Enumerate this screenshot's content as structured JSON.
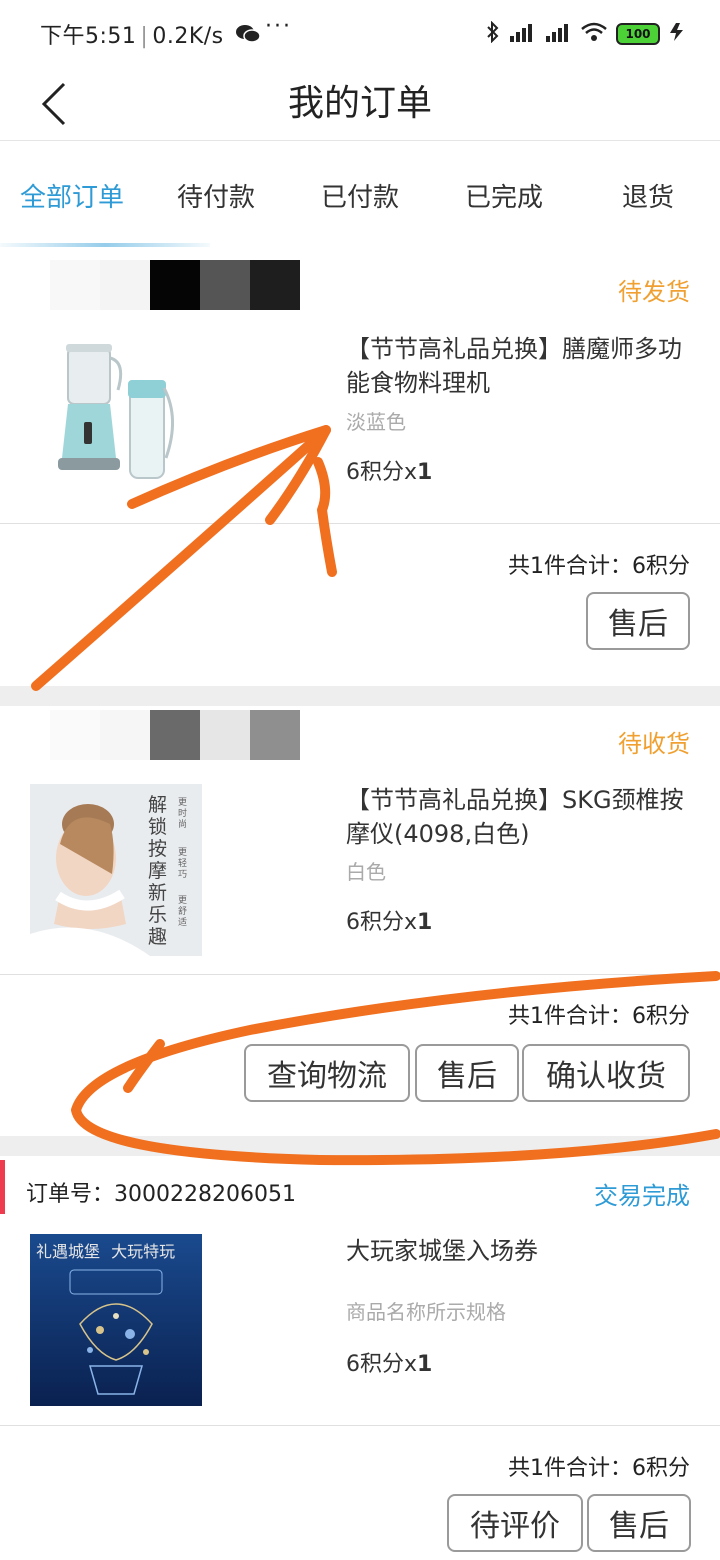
{
  "status_bar": {
    "time": "下午5:51",
    "speed": "0.2K/s",
    "dots": "···",
    "battery": "100"
  },
  "header": {
    "title": "我的订单"
  },
  "tabs": [
    {
      "label": "全部订单",
      "active": true
    },
    {
      "label": "待付款",
      "active": false
    },
    {
      "label": "已付款",
      "active": false
    },
    {
      "label": "已完成",
      "active": false
    },
    {
      "label": "退货",
      "active": false
    }
  ],
  "orders": [
    {
      "status": "待发货",
      "status_color": "#f0a030",
      "product_title": "【节节高礼品兑换】膳魔师多功能食物料理机",
      "spec": "淡蓝色",
      "price": "6积分x",
      "qty": "1",
      "total": "共1件合计：6积分",
      "buttons": [
        "售后"
      ]
    },
    {
      "status": "待收货",
      "status_color": "#f0a030",
      "product_title": "【节节高礼品兑换】SKG颈椎按摩仪(4098,白色)",
      "spec": "白色",
      "price": "6积分x",
      "qty": "1",
      "total": "共1件合计：6积分",
      "buttons": [
        "查询物流",
        "售后",
        "确认收货"
      ],
      "image_text": "解锁按摩新乐趣",
      "image_tags": [
        "更时尚",
        "更轻巧",
        "更舒适"
      ]
    },
    {
      "order_no": "订单号：3000228206051",
      "status": "交易完成",
      "status_color": "#2e9bd6",
      "product_title": "大玩家城堡入场券",
      "spec": "商品名称所示规格",
      "price": "6积分x",
      "qty": "1",
      "total": "共1件合计：6积分",
      "buttons": [
        "待评价",
        "售后"
      ],
      "image_text_1": "礼遇城堡",
      "image_text_2": "大玩特玩"
    }
  ],
  "colors": {
    "accent": "#2e9bd6",
    "pending": "#f0a030",
    "annotation": "#f07020"
  }
}
